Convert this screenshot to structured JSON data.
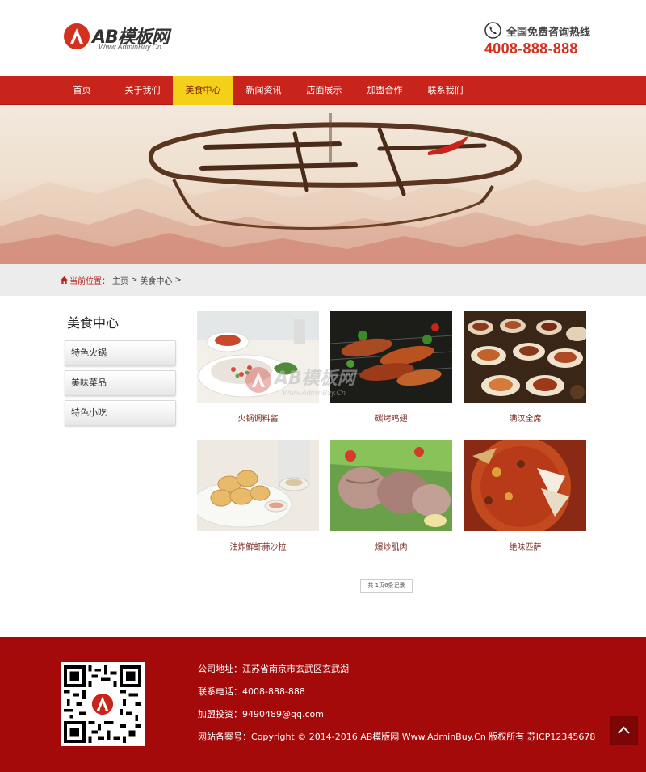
{
  "header": {
    "logo_text": "AB模板网",
    "logo_sub": "Www.AdminBuy.Cn",
    "hotline_label": "全国免费咨询热线",
    "hotline_number": "4008-888-888"
  },
  "nav": {
    "items": [
      {
        "label": "首页"
      },
      {
        "label": "关于我们"
      },
      {
        "label": "美食中心",
        "active": true
      },
      {
        "label": "新闻资讯"
      },
      {
        "label": "店面展示"
      },
      {
        "label": "加盟合作"
      },
      {
        "label": "联系我们"
      }
    ]
  },
  "breadcrumb": {
    "label": "当前位置：",
    "home": "主页",
    "sep1": ">",
    "current": "美食中心",
    "sep2": ">"
  },
  "sidebar": {
    "title": "美食中心",
    "items": [
      {
        "label": "特色火锅"
      },
      {
        "label": "美味菜品"
      },
      {
        "label": "特色小吃"
      }
    ]
  },
  "products": [
    {
      "caption": "火锅调料酱"
    },
    {
      "caption": "碳烤鸡翅"
    },
    {
      "caption": "满汉全席"
    },
    {
      "caption": "油炸鲜虾蒜沙拉"
    },
    {
      "caption": "爆炒肌肉"
    },
    {
      "caption": "绝味匹萨"
    }
  ],
  "pager": {
    "text": "共 1页6条记录"
  },
  "watermark": {
    "text": "AB模板网",
    "sub": "Www.AdminBuy.Cn"
  },
  "footer": {
    "address": "公司地址：江苏省南京市玄武区玄武湖",
    "phone": "联系电话：4008-888-888",
    "franchise": "加盟投资：9490489@qq.com",
    "icp": "网站备案号：Copyright © 2014-2016 AB模版网 Www.AdminBuy.Cn 版权所有   苏ICP12345678"
  },
  "colors": {
    "brand_red": "#c8241c",
    "nav_active": "#f5d01a",
    "footer_bg": "#a40a0a",
    "hotline": "#d4301e"
  },
  "icons": {
    "logo": "logo-icon",
    "phone": "phone-icon",
    "home": "home-icon",
    "to_top": "arrow-up-icon",
    "qr": "qr-code"
  }
}
